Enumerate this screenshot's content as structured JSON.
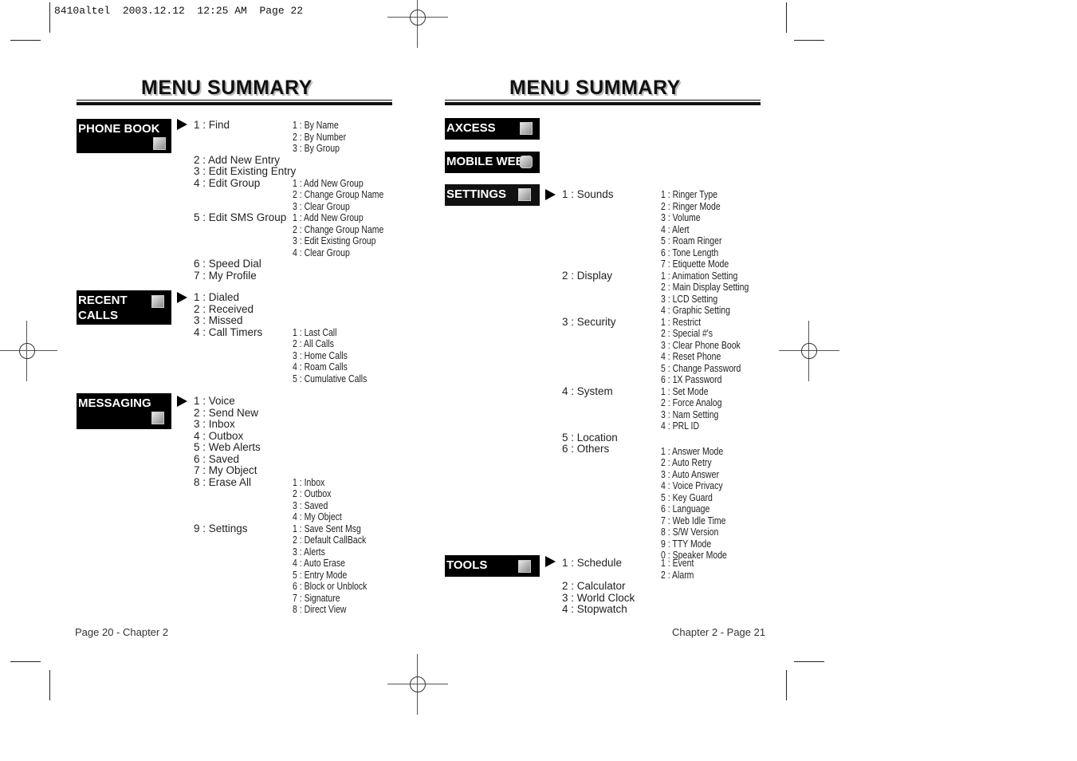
{
  "slug": "8410altel  2003.12.12  12:25 AM  Page 22",
  "left_page": {
    "title": "MENU SUMMARY",
    "footer": "Page 20 - Chapter 2",
    "categories": [
      {
        "label": "PHONE BOOK",
        "icon": "notepad-icon"
      },
      {
        "label": "RECENT\nCALLS",
        "icon": "phone-icon"
      },
      {
        "label": "MESSAGING",
        "icon": "envelope-pen-icon"
      }
    ],
    "phonebook": {
      "items": [
        "1 : Find",
        "2 : Add New Entry",
        "3 : Edit Existing Entry",
        "4 : Edit Group",
        "5 : Edit SMS Group",
        "6 : Speed Dial",
        "7 : My Profile"
      ],
      "find_sub": [
        "1 : By Name",
        "2 : By Number",
        "3 : By Group"
      ],
      "edit_group_sub": [
        "1 : Add New Group",
        "2 : Change Group Name",
        "3 : Clear Group"
      ],
      "edit_sms_group_sub": [
        "1 : Add New Group",
        "2 : Change Group Name",
        "3 : Edit Existing Group",
        "4 : Clear Group"
      ]
    },
    "recent_calls": {
      "items": [
        "1 : Dialed",
        "2 : Received",
        "3 : Missed",
        "4 : Call Timers"
      ],
      "call_timers_sub": [
        "1 : Last Call",
        "2 : All Calls",
        "3 : Home Calls",
        "4 : Roam Calls",
        "5 : Cumulative Calls"
      ]
    },
    "messaging": {
      "items": [
        "1 : Voice",
        "2 : Send New",
        "3 : Inbox",
        "4 : Outbox",
        "5 : Web Alerts",
        "6 : Saved",
        "7 : My Object",
        "8 : Erase All",
        "9 : Settings"
      ],
      "erase_all_sub": [
        "1 : Inbox",
        "2 : Outbox",
        "3 : Saved",
        "4 : My Object"
      ],
      "settings_sub": [
        "1 : Save Sent Msg",
        "2 : Default CallBack",
        "3 : Alerts",
        "4 : Auto Erase",
        "5 : Entry Mode",
        "6 : Block or Unblock",
        "7 : Signature",
        "8 : Direct View"
      ]
    }
  },
  "right_page": {
    "title": "MENU SUMMARY",
    "footer": "Chapter 2 - Page 21",
    "categories": [
      {
        "label": "AXCESS",
        "icon": "axcess-icon"
      },
      {
        "label": "MOBILE WEB",
        "icon": "info-icon"
      },
      {
        "label": "SETTINGS",
        "icon": "tools-icon"
      },
      {
        "label": "TOOLS",
        "icon": "calendar-clock-icon"
      }
    ],
    "settings": {
      "items": [
        "1 : Sounds",
        "2 : Display",
        "3 : Security",
        "4 : System",
        "5 : Location",
        "6 : Others"
      ],
      "sounds_sub": [
        "1 : Ringer Type",
        "2 : Ringer Mode",
        "3 : Volume",
        "4 : Alert",
        "5 : Roam Ringer",
        "6 : Tone Length",
        "7 : Etiquette Mode"
      ],
      "display_sub": [
        "1 : Animation Setting",
        "2 : Main Display Setting",
        "3 : LCD Setting",
        "4 : Graphic Setting"
      ],
      "security_sub": [
        "1 : Restrict",
        "2 : Special #'s",
        "3 : Clear Phone Book",
        "4 : Reset Phone",
        "5 : Change Password",
        "6 : 1X Password"
      ],
      "system_sub": [
        "1 : Set Mode",
        "2 : Force Analog",
        "3 : Nam Setting",
        "4 : PRL ID"
      ],
      "others_sub": [
        "1 : Answer Mode",
        "2 : Auto Retry",
        "3 : Auto Answer",
        "4 : Voice Privacy",
        "5 : Key Guard",
        "6 : Language",
        "7 : Web Idle Time",
        "8 : S/W Version",
        "9 : TTY Mode",
        "0 : Speaker Mode"
      ]
    },
    "tools": {
      "items": [
        "1 : Schedule",
        "2 : Calculator",
        "3 : World Clock",
        "4 : Stopwatch"
      ],
      "schedule_sub": [
        "1 : Event",
        "2 : Alarm"
      ]
    }
  }
}
